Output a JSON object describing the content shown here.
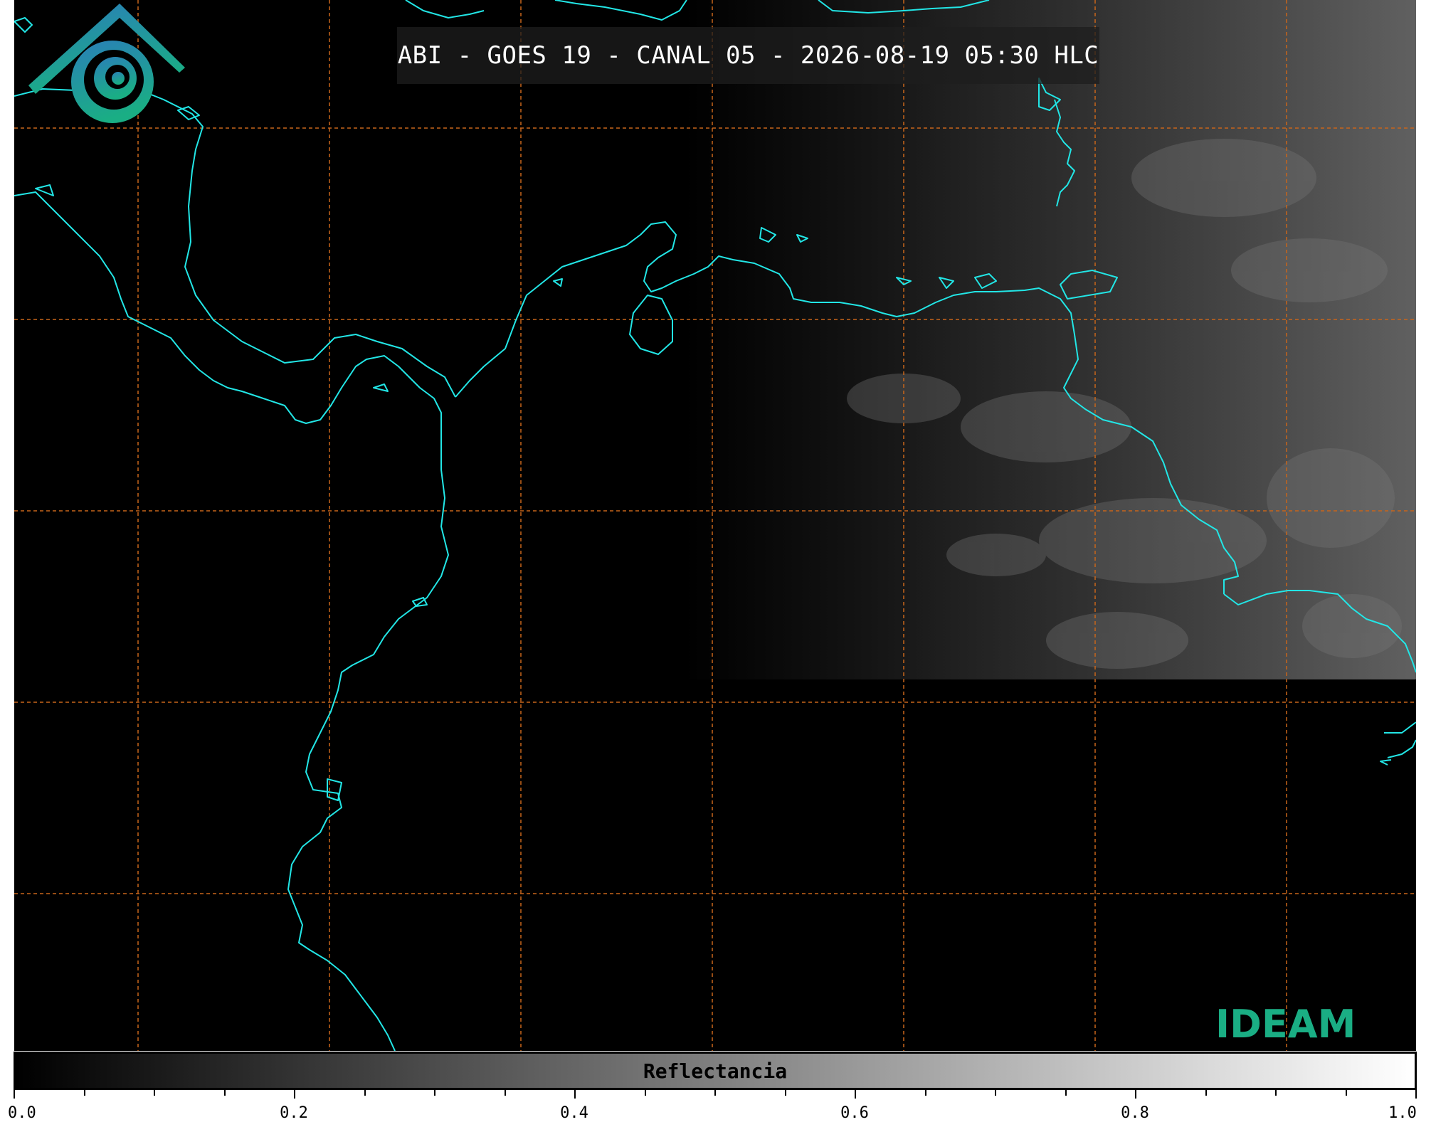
{
  "title": "ABI - GOES 19 - CANAL 05 - 2026-08-19 05:30 HLC",
  "colors": {
    "background": "#000000",
    "coastline": "#22e6e6",
    "gridline": "#c8651b",
    "logo_blue": "#2a7fb8",
    "logo_green": "#1aae84"
  },
  "map": {
    "gridlines": "dashed",
    "coastline_icon": "coastline-path"
  },
  "logo": {
    "text": "IDEAM",
    "icon": "ideam-logo-icon"
  },
  "colorbar": {
    "label": "Reflectancia",
    "min": 0.0,
    "max": 1.0,
    "gradient": [
      "#000000",
      "#ffffff"
    ],
    "tick_labels": [
      "0.0",
      "0.2",
      "0.4",
      "0.6",
      "0.8",
      "1.0"
    ],
    "tick_values": [
      0.0,
      0.2,
      0.4,
      0.6,
      0.8,
      1.0
    ],
    "minor_step": 0.05
  }
}
